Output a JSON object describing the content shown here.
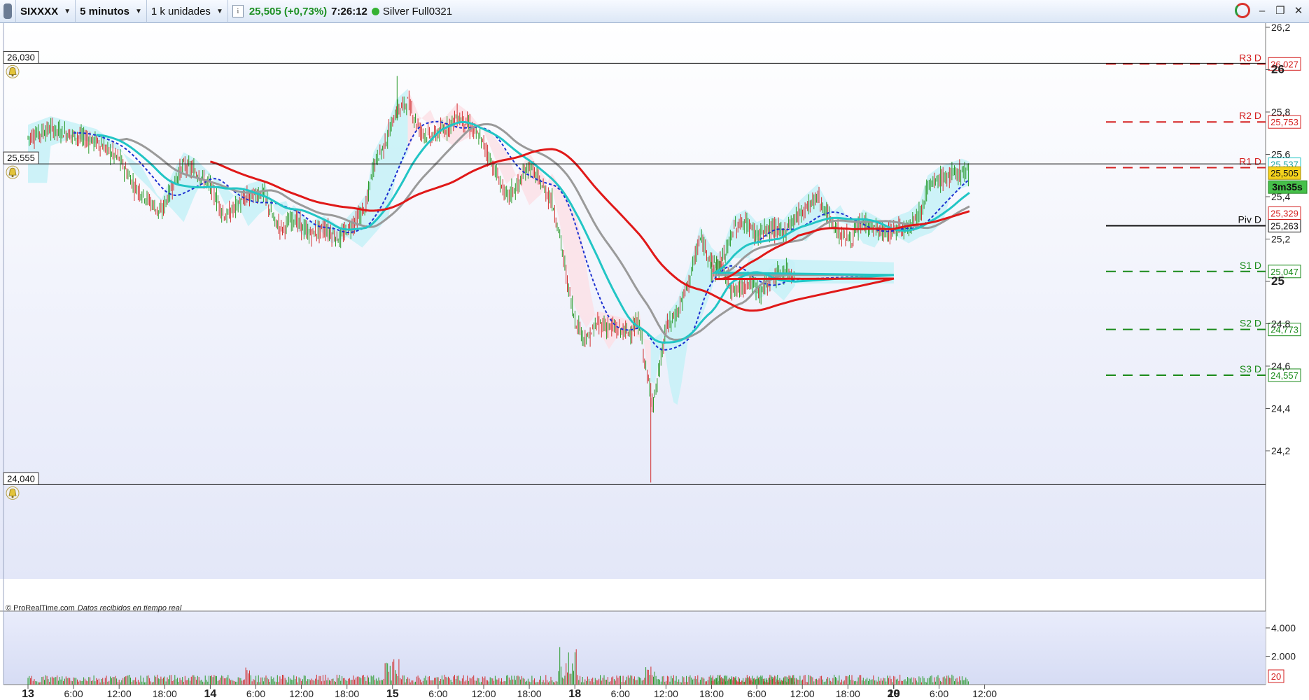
{
  "toolbar": {
    "symbol": "SIXXXX",
    "timeframe": "5 minutos",
    "units": "1 k unidades",
    "info_icon": "i",
    "price_change": "25,505 (+0,73%)",
    "time": "7:26:12",
    "account": "Silver Full0321"
  },
  "window_controls": {
    "refresh_icon": "refresh-icon",
    "minimize": "–",
    "restore": "❐",
    "close": "✕"
  },
  "chart": {
    "price_axis": {
      "labels": [
        "26,2",
        "26",
        "25,8",
        "25,6",
        "25,4",
        "25,2",
        "25",
        "24,8",
        "24,6",
        "24,4",
        "24,2"
      ],
      "bold_labels": [
        "26",
        "25"
      ]
    },
    "alert_lines": [
      {
        "label": "26,030"
      },
      {
        "label": "25,555"
      },
      {
        "label": "24,040"
      }
    ],
    "pivot_levels": [
      {
        "name": "R3 D",
        "value": "26,027",
        "color": "#d42020"
      },
      {
        "name": "R2 D",
        "value": "25,753",
        "color": "#d42020"
      },
      {
        "name": "R1 D",
        "value": "25,537",
        "color": "#d42020"
      },
      {
        "name": "Piv D",
        "value": "25,263",
        "color": "#111111"
      },
      {
        "name": "S1 D",
        "value": "25,047",
        "color": "#1a8a1a"
      },
      {
        "name": "S2 D",
        "value": "24,773",
        "color": "#1a8a1a"
      },
      {
        "name": "S3 D",
        "value": "24,557",
        "color": "#1a8a1a"
      }
    ],
    "axis_badges": {
      "ichimoku_value": "25,537",
      "current_price": "25,505",
      "countdown": "3m35s",
      "ma_value": "25,329"
    },
    "time_axis": [
      {
        "label": "13",
        "bold": true
      },
      {
        "label": "6:00"
      },
      {
        "label": "12:00"
      },
      {
        "label": "18:00"
      },
      {
        "label": "14",
        "bold": true
      },
      {
        "label": "6:00"
      },
      {
        "label": "12:00"
      },
      {
        "label": "18:00"
      },
      {
        "label": "15",
        "bold": true
      },
      {
        "label": "6:00"
      },
      {
        "label": "12:00"
      },
      {
        "label": "18:00"
      },
      {
        "label": "18",
        "bold": true
      },
      {
        "label": "6:00"
      },
      {
        "label": "12:00"
      },
      {
        "label": "18:00"
      },
      {
        "label": "19",
        "bold": true
      },
      {
        "label": "6:00"
      },
      {
        "label": "12:00"
      },
      {
        "label": "18:00"
      },
      {
        "label": "20",
        "bold": true
      },
      {
        "label": "6:00"
      },
      {
        "label": "12:00"
      }
    ],
    "copyright": "© ProRealTime.com",
    "data_note": "Datos recibidos en tiempo real",
    "volume_axis": {
      "labels": [
        "4.000",
        "2.000"
      ],
      "current_volume": "20"
    },
    "colors": {
      "up_candle": "#2a9a2a",
      "down_candle": "#d23030",
      "ma_red": "#e01818",
      "kijun_gray": "#9a9a9a",
      "tenkan_teal": "#22c5c5",
      "dotted_blue": "#1b2fd0",
      "cloud_cyan": "#c5f1f7",
      "cloud_pink": "#fbe1e6"
    }
  }
}
